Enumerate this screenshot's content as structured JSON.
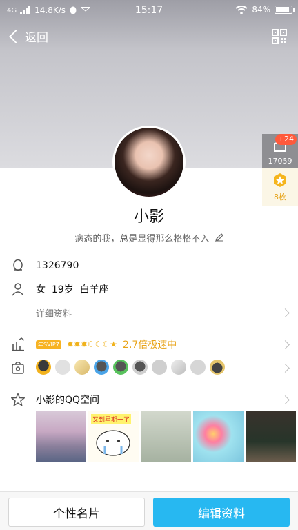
{
  "status_bar": {
    "network": "4G",
    "speed": "14.8K/s",
    "time": "15:17",
    "battery": "84%"
  },
  "header": {
    "back_label": "返回"
  },
  "side_badges": {
    "likes_plus": "+24",
    "likes_count": "17059",
    "medals_count": "8枚"
  },
  "profile": {
    "name": "小影",
    "signature": "病态的我，总是显得那么格格不入"
  },
  "info": {
    "qq_number": "1326790",
    "gender_age_sign": "女  19岁  白羊座",
    "details_link": "详细资料"
  },
  "vip": {
    "badge": "年SVIP7",
    "suns": "✹✹✹☾☾☾★",
    "speed": "2.7倍极速中"
  },
  "qzone": {
    "title": "小影的QQ空间",
    "photo2_caption": "又到星期一了"
  },
  "bottom": {
    "card_button": "个性名片",
    "edit_button": "编辑资料"
  }
}
